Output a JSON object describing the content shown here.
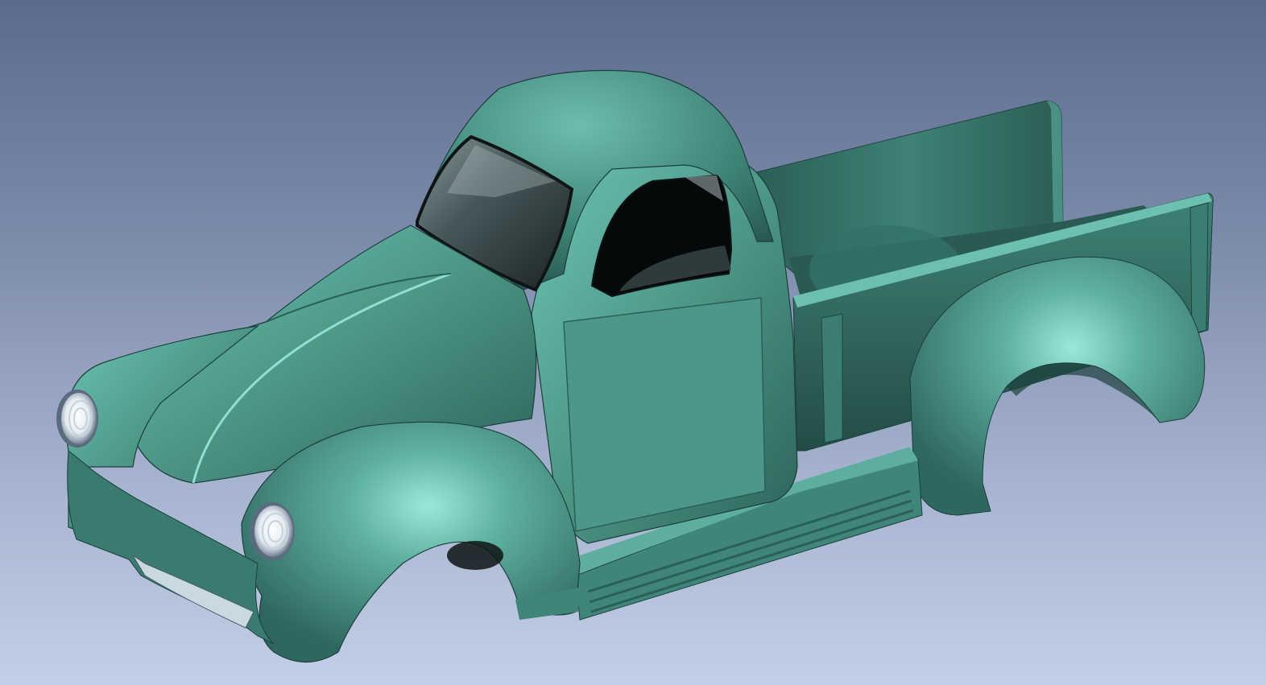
{
  "viewport": {
    "background_top": "#5c6b8c",
    "background_bottom": "#c3cfe8"
  },
  "model": {
    "subject": "pickup-truck-body",
    "paint_color": "#4f9a8b",
    "paint_highlight": "#8fe0d2",
    "paint_shadow": "#1f4a45",
    "glass_color": "#2f3a3a",
    "interior_color": "#0a0f0f",
    "chrome_color": "#e6eef5"
  }
}
